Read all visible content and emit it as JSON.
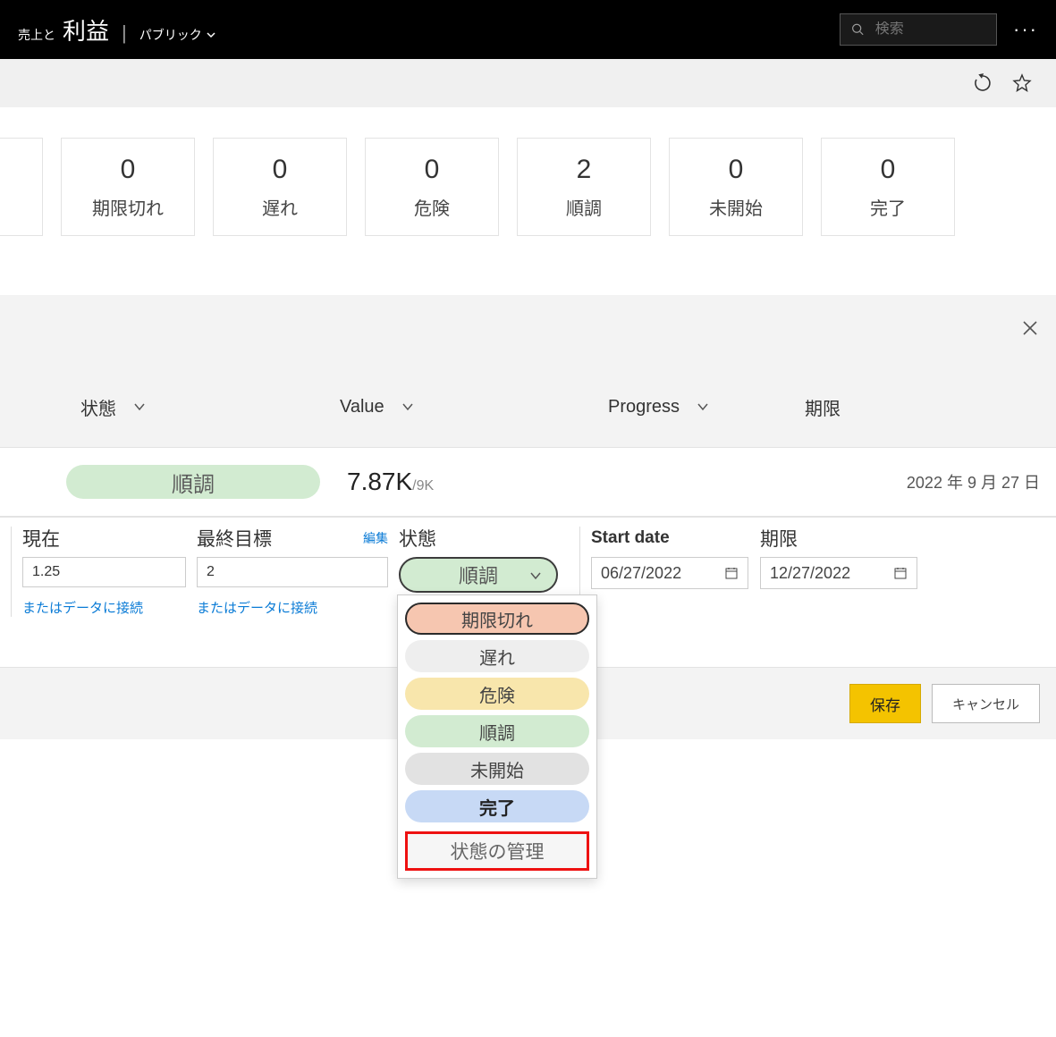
{
  "header": {
    "subtitle": "売上と",
    "title": "利益",
    "status": "パブリック",
    "search_placeholder": "検索"
  },
  "tiles": [
    {
      "value": "0",
      "label": "期限切れ"
    },
    {
      "value": "0",
      "label": "遅れ"
    },
    {
      "value": "0",
      "label": "危険"
    },
    {
      "value": "2",
      "label": "順調"
    },
    {
      "value": "0",
      "label": "未開始"
    },
    {
      "value": "0",
      "label": "完了"
    }
  ],
  "columns": {
    "status": "状態",
    "value": "Value",
    "progress": "Progress",
    "deadline": "期限"
  },
  "row": {
    "status": "順調",
    "value_main": "7.87K",
    "value_sub": "/9K",
    "deadline": "2022 年 9 月 27 日"
  },
  "edit": {
    "current_label": "現在",
    "current_value": "1.25",
    "current_link": "またはデータに接続",
    "target_label": "最終目標",
    "target_edit": "編集",
    "target_value": "2",
    "target_link": "またはデータに接続",
    "status_label": "状態",
    "status_value": "順調",
    "start_label": "Start date",
    "start_value": "06/27/2022",
    "end_label": "期限",
    "end_value": "12/27/2022"
  },
  "dropdown": {
    "overdue": "期限切れ",
    "late": "遅れ",
    "risk": "危険",
    "track": "順調",
    "notstarted": "未開始",
    "done": "完了",
    "manage": "状態の管理"
  },
  "buttons": {
    "save": "保存",
    "cancel": "キャンセル"
  }
}
